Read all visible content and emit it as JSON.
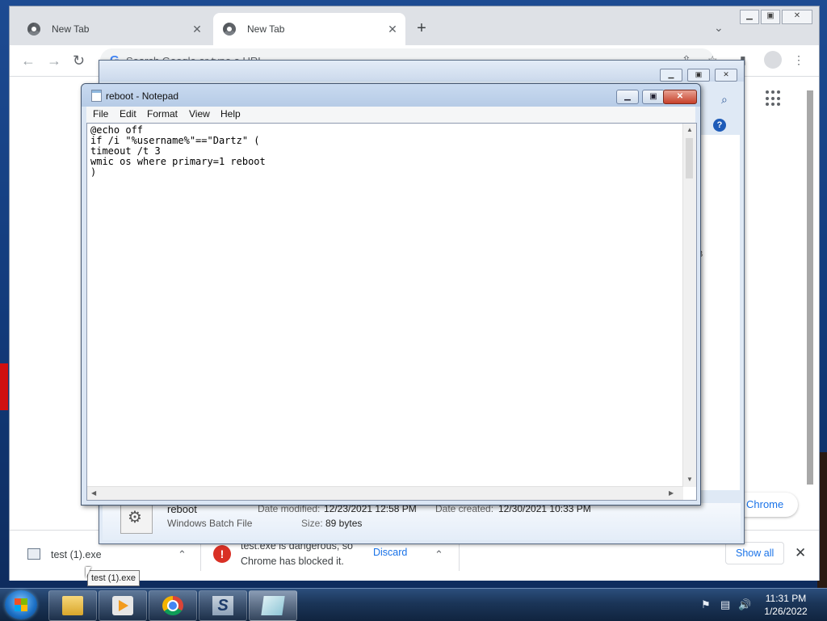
{
  "browser": {
    "tabs": [
      {
        "label": "New Tab"
      },
      {
        "label": "New Tab"
      }
    ],
    "omnibox_placeholder": "Search Google or type a URL",
    "chrome_pill_label": "Chrome",
    "download_bar": {
      "item1_name": "test (1).exe",
      "item2_message": "test.exe is dangerous, so Chrome has blocked it.",
      "discard_label": "Discard",
      "show_all_label": "Show all"
    },
    "tooltip": "test (1).exe"
  },
  "explorer": {
    "details": {
      "name": "reboot",
      "type": "Windows Batch File",
      "date_modified_label": "Date modified:",
      "date_modified": "12/23/2021 12:58 PM",
      "date_created_label": "Date created:",
      "date_created": "12/30/2021 10:33 PM",
      "size_label": "Size:",
      "size": "89 bytes"
    },
    "side_letter": "B"
  },
  "notepad": {
    "title": "reboot - Notepad",
    "menu": [
      "File",
      "Edit",
      "Format",
      "View",
      "Help"
    ],
    "content": "@echo off\nif /i \"%username%\"==\"Dartz\" (\ntimeout /t 3\nwmic os where primary=1 reboot\n)"
  },
  "taskbar": {
    "time": "11:31 PM",
    "date": "1/26/2022"
  }
}
